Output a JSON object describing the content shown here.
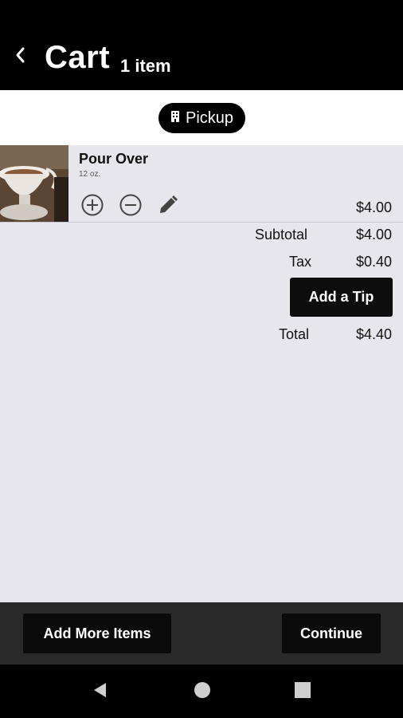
{
  "header": {
    "title": "Cart",
    "item_count": "1 item"
  },
  "order_mode": {
    "label": "Pickup"
  },
  "cart_items": [
    {
      "name": "Pour Over",
      "size": "12 oz.",
      "price": "$4.00"
    }
  ],
  "summary": {
    "subtotal_label": "Subtotal",
    "subtotal_value": "$4.00",
    "tax_label": "Tax",
    "tax_value": "$0.40",
    "tip_button_label": "Add a Tip",
    "total_label": "Total",
    "total_value": "$4.40"
  },
  "footer": {
    "add_more_label": "Add More Items",
    "continue_label": "Continue"
  },
  "icons": {
    "back": "chevron-left-icon",
    "pickup": "store-icon",
    "increase": "plus-circle-icon",
    "decrease": "minus-circle-icon",
    "edit": "pencil-icon",
    "nav_back": "triangle-back-icon",
    "nav_home": "circle-home-icon",
    "nav_recents": "square-recents-icon"
  },
  "colors": {
    "header_bg": "#000000",
    "page_bg": "#e7e6ec",
    "button_bg": "#0d0d0d",
    "footer_bg": "#2a2a2a"
  }
}
